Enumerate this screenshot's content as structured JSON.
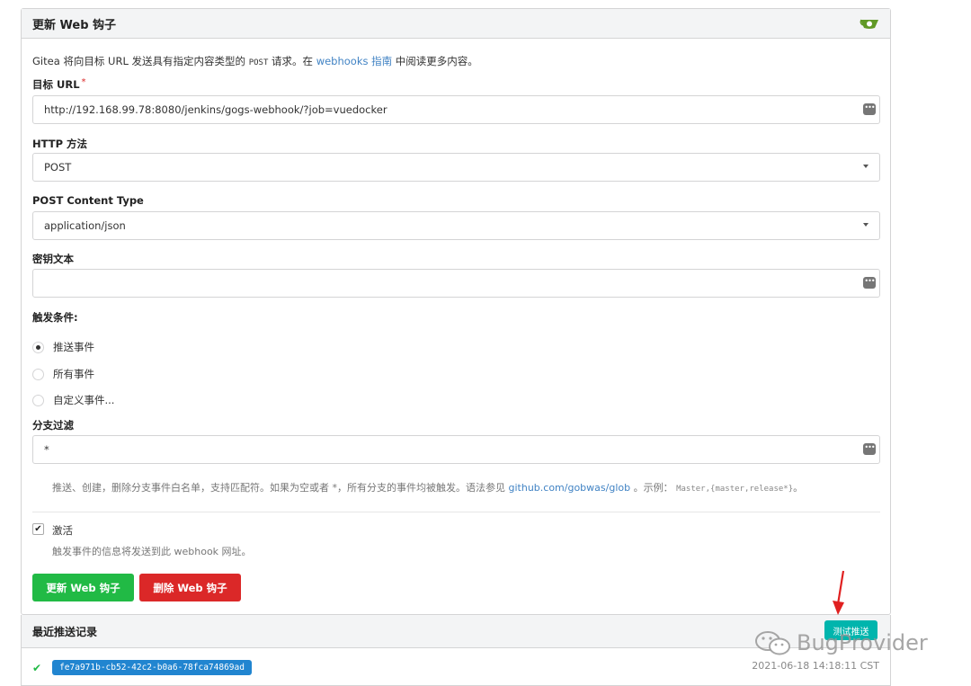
{
  "header": {
    "title": "更新 Web 钩子"
  },
  "intro": {
    "prefix": "Gitea 将向目标 URL 发送具有指定内容类型的",
    "code": "POST",
    "middle": "请求。在",
    "link": "webhooks 指南",
    "suffix": "中阅读更多内容。"
  },
  "target_url": {
    "label": "目标 URL",
    "required_mark": "*",
    "value": "http://192.168.99.78:8080/jenkins/gogs-webhook/?job=vuedocker"
  },
  "http_method": {
    "label": "HTTP 方法",
    "value": "POST"
  },
  "content_type": {
    "label": "POST Content Type",
    "value": "application/json"
  },
  "secret": {
    "label": "密钥文本",
    "value": ""
  },
  "trigger": {
    "label": "触发条件:",
    "options": [
      {
        "label": "推送事件",
        "checked": true
      },
      {
        "label": "所有事件",
        "checked": false
      },
      {
        "label": "自定义事件...",
        "checked": false
      }
    ]
  },
  "branch_filter": {
    "label": "分支过滤",
    "value": "*",
    "help_prefix": "推送、创建，删除分支事件白名单，支持匹配符。如果为空或者 *，所有分支的事件均被触发。语法参见",
    "help_link": "github.com/gobwas/glob",
    "help_mid": "。示例：",
    "help_code": "Master,{master,release*}",
    "help_suffix": "。"
  },
  "active": {
    "label": "激活",
    "checked": true,
    "help": "触发事件的信息将发送到此 webhook 网址。"
  },
  "buttons": {
    "update": "更新 Web 钩子",
    "delete": "删除 Web 钩子"
  },
  "recent": {
    "title": "最近推送记录",
    "test_button": "测试推送",
    "deliveries": [
      {
        "id": "fe7a971b-cb52-42c2-b0a6-78fca74869ad",
        "time": "2021-06-18 14:18:11 CST",
        "status_icon": "check-icon"
      }
    ]
  },
  "watermark": {
    "text": "BugProvider"
  },
  "colors": {
    "green": "#21ba45",
    "red": "#db2828",
    "teal": "#00b5ad",
    "link": "#4183c4",
    "badge": "#2185d0"
  }
}
